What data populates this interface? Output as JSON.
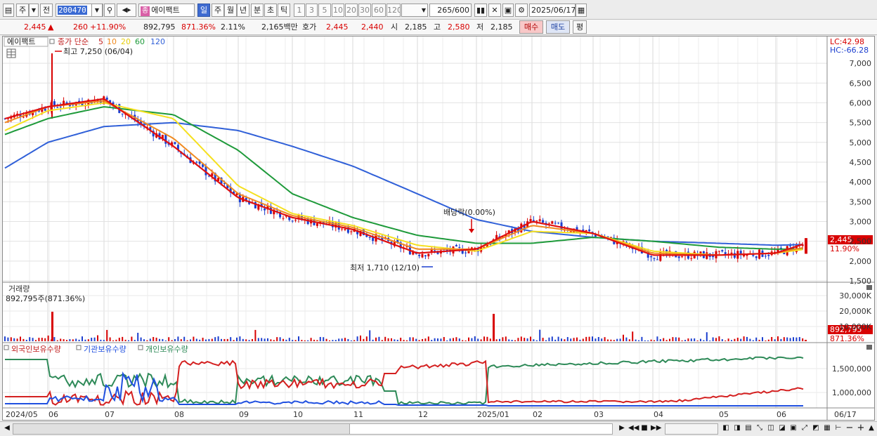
{
  "toolbar": {
    "market": "주",
    "prefix": "전",
    "code": "200470",
    "stock_name": "에이팩트",
    "stock_badge": "종",
    "periods": [
      "일",
      "주",
      "월",
      "년",
      "분",
      "초",
      "틱"
    ],
    "active_period": "일",
    "minutes": [
      "1",
      "3",
      "5",
      "10",
      "20",
      "30",
      "60",
      "120"
    ],
    "count": "265",
    "count_max": "/600",
    "date": "2025/06/17"
  },
  "quote": {
    "price": "2,445",
    "arrow": "▲",
    "change": "260",
    "change_pct": "+11.90%",
    "volume": "892,795",
    "volume_pct": "871.36%",
    "turnover": "2.11%",
    "amount": "2,165백만",
    "bid_label": "호가",
    "ask": "2,445",
    "bid": "2,440",
    "open_label": "시",
    "open": "2,185",
    "high_label": "고",
    "high": "2,580",
    "low_label": "저",
    "low": "2,185",
    "buy_label": "매수",
    "sell_label": "매도",
    "avg_label": "평"
  },
  "price_panel": {
    "stock_tag": "에이팩트",
    "ma_label": "종가 단순",
    "ma_periods": [
      "5",
      "10",
      "20",
      "60",
      "120"
    ],
    "high_annotation": "최고 7,250 (06/04)",
    "low_annotation": "최저 1,710 (12/10)",
    "dividend_annotation": "배당락(0.00%)",
    "lc": "LC:42.98",
    "hc": "HC:-66.28",
    "price_ticks": [
      "7,000",
      "6,500",
      "6,000",
      "5,500",
      "5,000",
      "4,500",
      "4,000",
      "3,500",
      "3,000",
      "2,500",
      "2,000",
      "1,500"
    ],
    "last_price_tag": "2,445",
    "last_pct_tag": "11.90%"
  },
  "volume_panel": {
    "title": "거래량",
    "info": "892,795주(871.36%)",
    "ticks": [
      "30,000K",
      "20,000K",
      "10,000K"
    ],
    "last_tag": "892,795",
    "last_pct_tag": "871.36%"
  },
  "holdings_panel": {
    "legend": [
      "외국인보유수량",
      "기관보유수량",
      "개인보유수량"
    ],
    "ticks": [
      "1,500,000",
      "1,000,000"
    ]
  },
  "xaxis": [
    "2024/05",
    "06",
    "07",
    "08",
    "09",
    "10",
    "11",
    "12",
    "2025/01",
    "02",
    "03",
    "04",
    "05",
    "06",
    "06/17"
  ],
  "colors": {
    "up": "#d80000",
    "down": "#1c3fcf",
    "ma5": "#e01010",
    "ma10": "#f08a20",
    "ma20": "#f5e020",
    "ma60": "#1e9a3a",
    "ma120": "#3060d8",
    "foreign": "#d42020",
    "inst": "#2050e0",
    "indiv": "#2e8a58"
  },
  "chart_data": {
    "type": "line",
    "title": "에이팩트",
    "x": [
      "2024/05",
      "06",
      "07",
      "08",
      "09",
      "10",
      "11",
      "12",
      "2025/01",
      "02",
      "03",
      "04",
      "05",
      "06",
      "06/17"
    ],
    "ylim": [
      1500,
      7250
    ],
    "series": [
      {
        "name": "5",
        "values": [
          5600,
          5900,
          6100,
          4900,
          3600,
          3100,
          2800,
          2200,
          2300,
          3000,
          2700,
          2150,
          2150,
          2200,
          2445
        ]
      },
      {
        "name": "10",
        "values": [
          5500,
          5900,
          6050,
          5100,
          3700,
          3150,
          2850,
          2300,
          2300,
          2900,
          2700,
          2200,
          2150,
          2200,
          2350
        ]
      },
      {
        "name": "20",
        "values": [
          5300,
          5800,
          6000,
          5600,
          3900,
          3200,
          2900,
          2400,
          2250,
          2750,
          2700,
          2250,
          2150,
          2200,
          2300
        ]
      },
      {
        "name": "60",
        "values": [
          5200,
          5600,
          5900,
          5700,
          4800,
          3700,
          3100,
          2650,
          2450,
          2450,
          2600,
          2500,
          2350,
          2300,
          2300
        ]
      },
      {
        "name": "120",
        "values": [
          4350,
          5000,
          5400,
          5500,
          5300,
          4900,
          4400,
          3700,
          3050,
          2750,
          2600,
          2500,
          2450,
          2400,
          2420
        ]
      }
    ],
    "annotations": [
      "최고 7,250 (06/04)",
      "최저 1,710 (12/10)",
      "배당락(0.00%)"
    ]
  }
}
